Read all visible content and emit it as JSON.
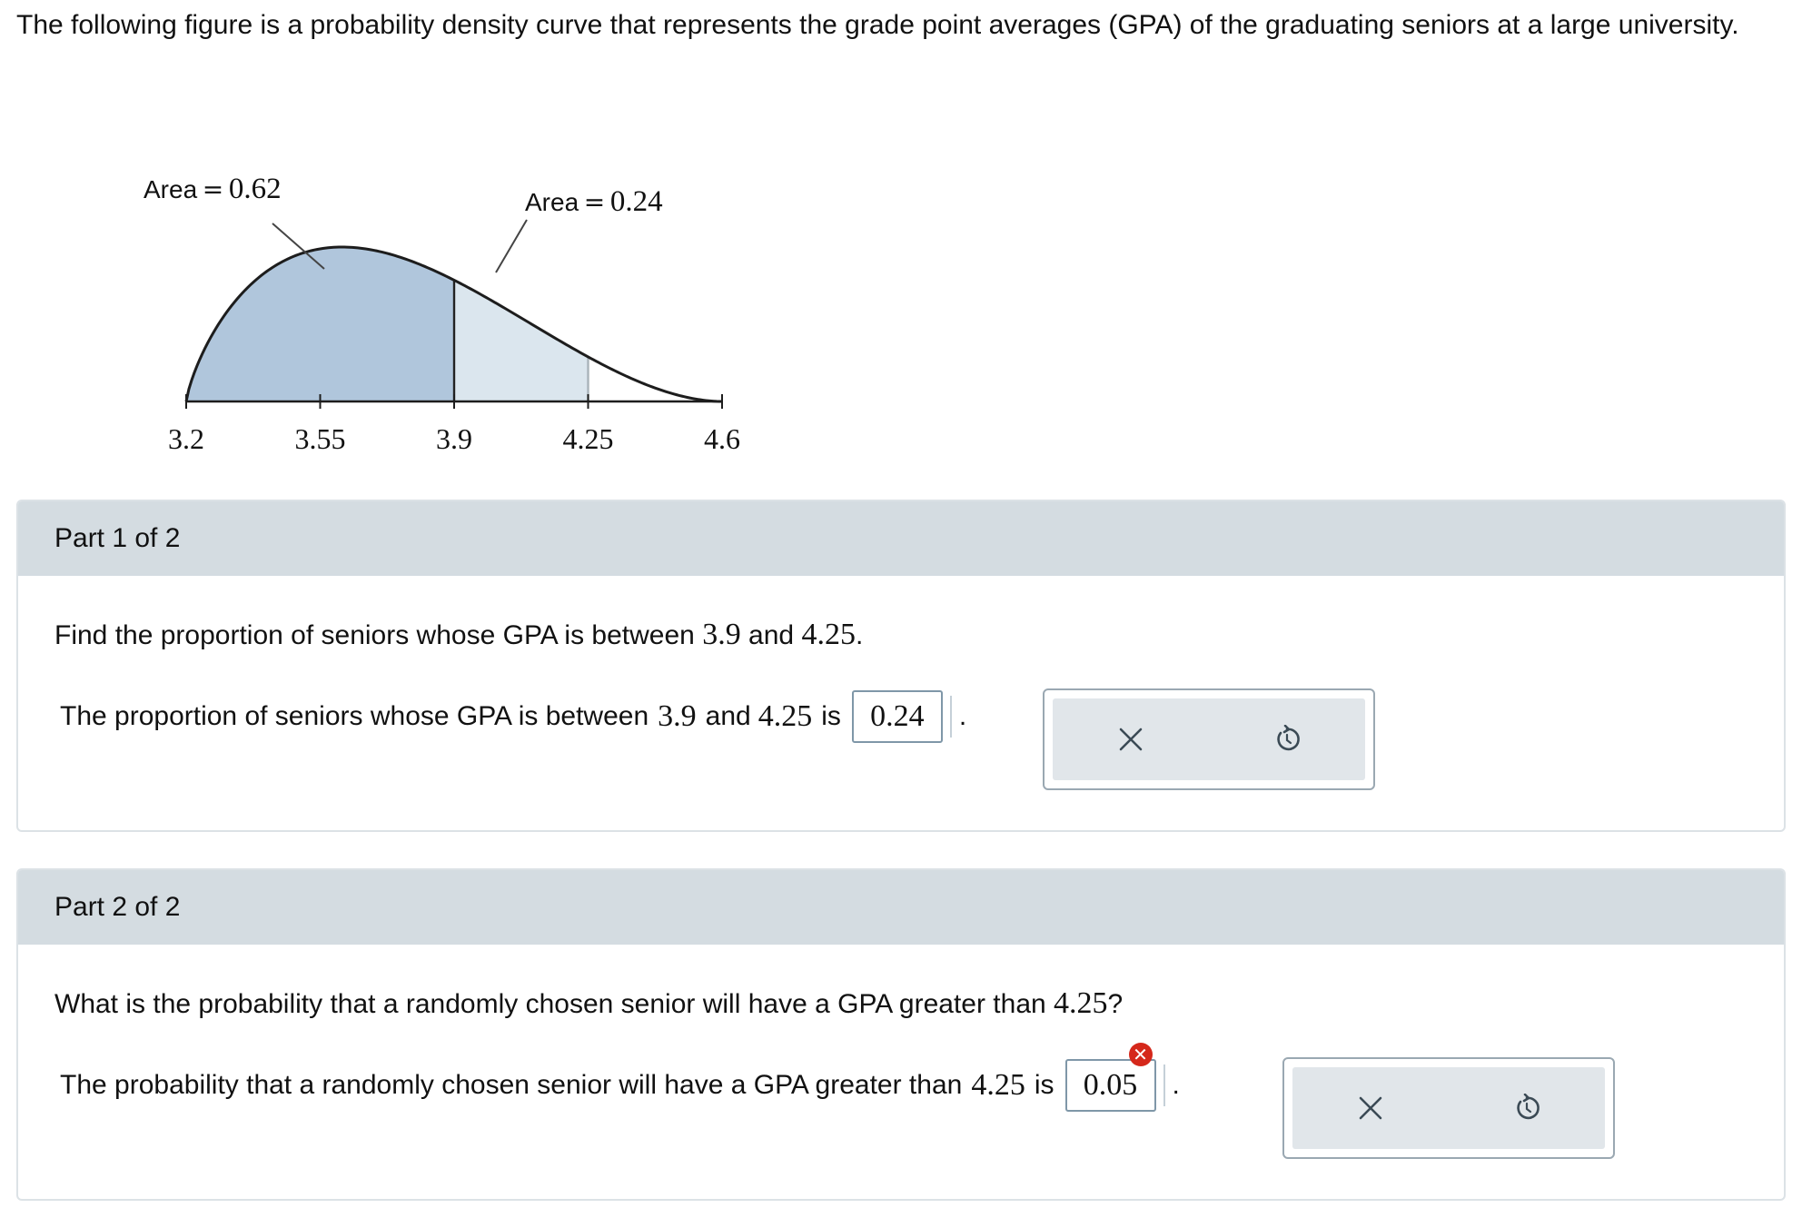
{
  "intro_text": "The following figure is a probability density curve that represents the grade point averages (GPA) of the graduating seniors at a large university.",
  "chart_data": {
    "type": "area",
    "x_ticks": [
      "3.2",
      "3.55",
      "3.9",
      "4.25",
      "4.6"
    ],
    "xlim": [
      3.2,
      4.6
    ],
    "regions": [
      {
        "from": 3.2,
        "to": 3.9,
        "area": 0.62,
        "label_prefix": "Area",
        "label_value": "0.62",
        "fill": "#b0c6dc"
      },
      {
        "from": 3.9,
        "to": 4.25,
        "area": 0.24,
        "label_prefix": "Area",
        "label_value": "0.24",
        "fill": "#dbe6ee"
      },
      {
        "from": 4.25,
        "to": 4.6,
        "fill": "#ffffff"
      }
    ]
  },
  "part1": {
    "header": "Part 1 of 2",
    "question_prefix": "Find the proportion of seniors whose GPA is between",
    "q_num_a": "3.9",
    "q_mid": "and",
    "q_num_b": "4.25",
    "q_suffix": ".",
    "answer_prefix": "The proportion of seniors whose GPA is between",
    "a_num_a": "3.9",
    "a_mid": "and",
    "a_num_b": "4.25",
    "a_is": "is",
    "answer_value": "0.24",
    "period": "."
  },
  "part2": {
    "header": "Part 2 of 2",
    "question_prefix": "What is the probability that a randomly chosen senior will have a GPA greater than",
    "q_num": "4.25",
    "q_suffix": "?",
    "answer_prefix": "The probability that a randomly chosen senior will have a GPA greater than",
    "a_num": "4.25",
    "a_is": "is",
    "answer_value": "0.05",
    "answer_status": "incorrect",
    "error_glyph": "✕",
    "period": "."
  },
  "icons": {
    "clear": "close-icon",
    "retry": "undo-icon",
    "error": "error-badge-icon"
  },
  "colors": {
    "header_bg": "#d4dce1",
    "error": "#d5281b",
    "dark_region": "#b0c6dc",
    "light_region": "#dbe6ee"
  }
}
